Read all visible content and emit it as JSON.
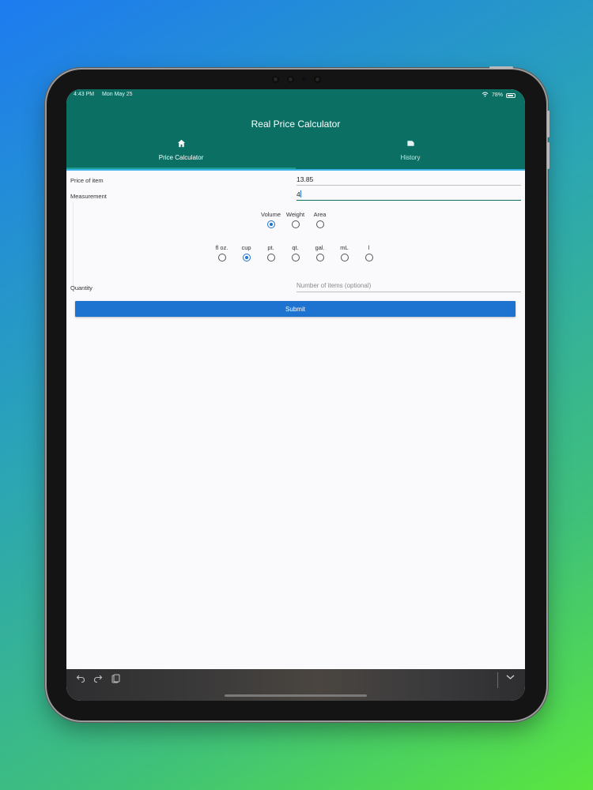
{
  "status_bar": {
    "time": "4:43 PM",
    "date": "Mon May 25",
    "battery": "78%"
  },
  "app": {
    "title": "Real Price Calculator"
  },
  "tabs": [
    {
      "label": "Price Calculator",
      "icon": "home-icon",
      "active": true
    },
    {
      "label": "History",
      "icon": "history-icon",
      "active": false
    }
  ],
  "form": {
    "price": {
      "label": "Price of item",
      "value": "13.85"
    },
    "measurement": {
      "label": "Measurement",
      "value": "4"
    },
    "type_options": [
      {
        "label": "Volume",
        "checked": true
      },
      {
        "label": "Weight",
        "checked": false
      },
      {
        "label": "Area",
        "checked": false
      }
    ],
    "unit_options": [
      {
        "label": "fl oz.",
        "checked": false
      },
      {
        "label": "cup",
        "checked": true
      },
      {
        "label": "pt.",
        "checked": false
      },
      {
        "label": "qt.",
        "checked": false
      },
      {
        "label": "gal.",
        "checked": false
      },
      {
        "label": "mL",
        "checked": false
      },
      {
        "label": "l",
        "checked": false
      }
    ],
    "quantity": {
      "label": "Quantity",
      "placeholder": "Number of items (optional)"
    },
    "submit_label": "Submit"
  },
  "colors": {
    "header": "#0b6f63",
    "accent": "#1e73d0"
  }
}
